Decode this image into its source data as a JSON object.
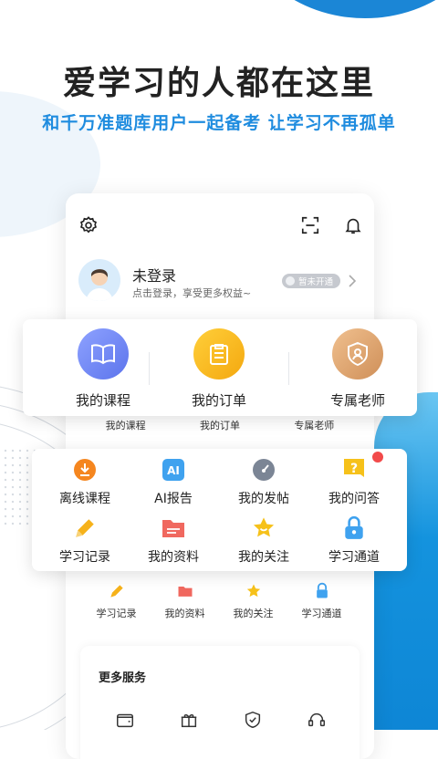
{
  "hero": {
    "title": "爱学习的人都在这里",
    "subtitle": "和千万准题库用户一起备考 让学习不再孤单"
  },
  "profile": {
    "name": "未登录",
    "hint": "点击登录，享受更多权益~",
    "vip_status": "暂未开通"
  },
  "main_actions": [
    {
      "label": "我的课程",
      "icon": "book-icon",
      "color": "#6f86f0"
    },
    {
      "label": "我的订单",
      "icon": "clipboard-icon",
      "color": "#f6b21a"
    },
    {
      "label": "专属老师",
      "icon": "teacher-badge-icon",
      "color": "#d9a06d"
    }
  ],
  "main_actions_inner": [
    "我的课程",
    "我的订单",
    "专属老师"
  ],
  "tools": [
    {
      "label": "离线课程",
      "icon": "download-icon"
    },
    {
      "label": "AI报告",
      "icon": "ai-icon"
    },
    {
      "label": "我的发帖",
      "icon": "gauge-icon"
    },
    {
      "label": "我的问答",
      "icon": "question-icon"
    },
    {
      "label": "学习记录",
      "icon": "pencil-icon"
    },
    {
      "label": "我的资料",
      "icon": "folder-icon"
    },
    {
      "label": "我的关注",
      "icon": "star-icon"
    },
    {
      "label": "学习通道",
      "icon": "lock-icon"
    }
  ],
  "tools_inner": [
    "学习记录",
    "我的资料",
    "我的关注",
    "学习通道"
  ],
  "more_services": {
    "title": "更多服务",
    "icons": [
      "wallet-icon",
      "gift-icon",
      "shield-icon",
      "headset-icon"
    ]
  },
  "colors": {
    "accent": "#1f8cdf",
    "notification": "#f24a4a"
  }
}
